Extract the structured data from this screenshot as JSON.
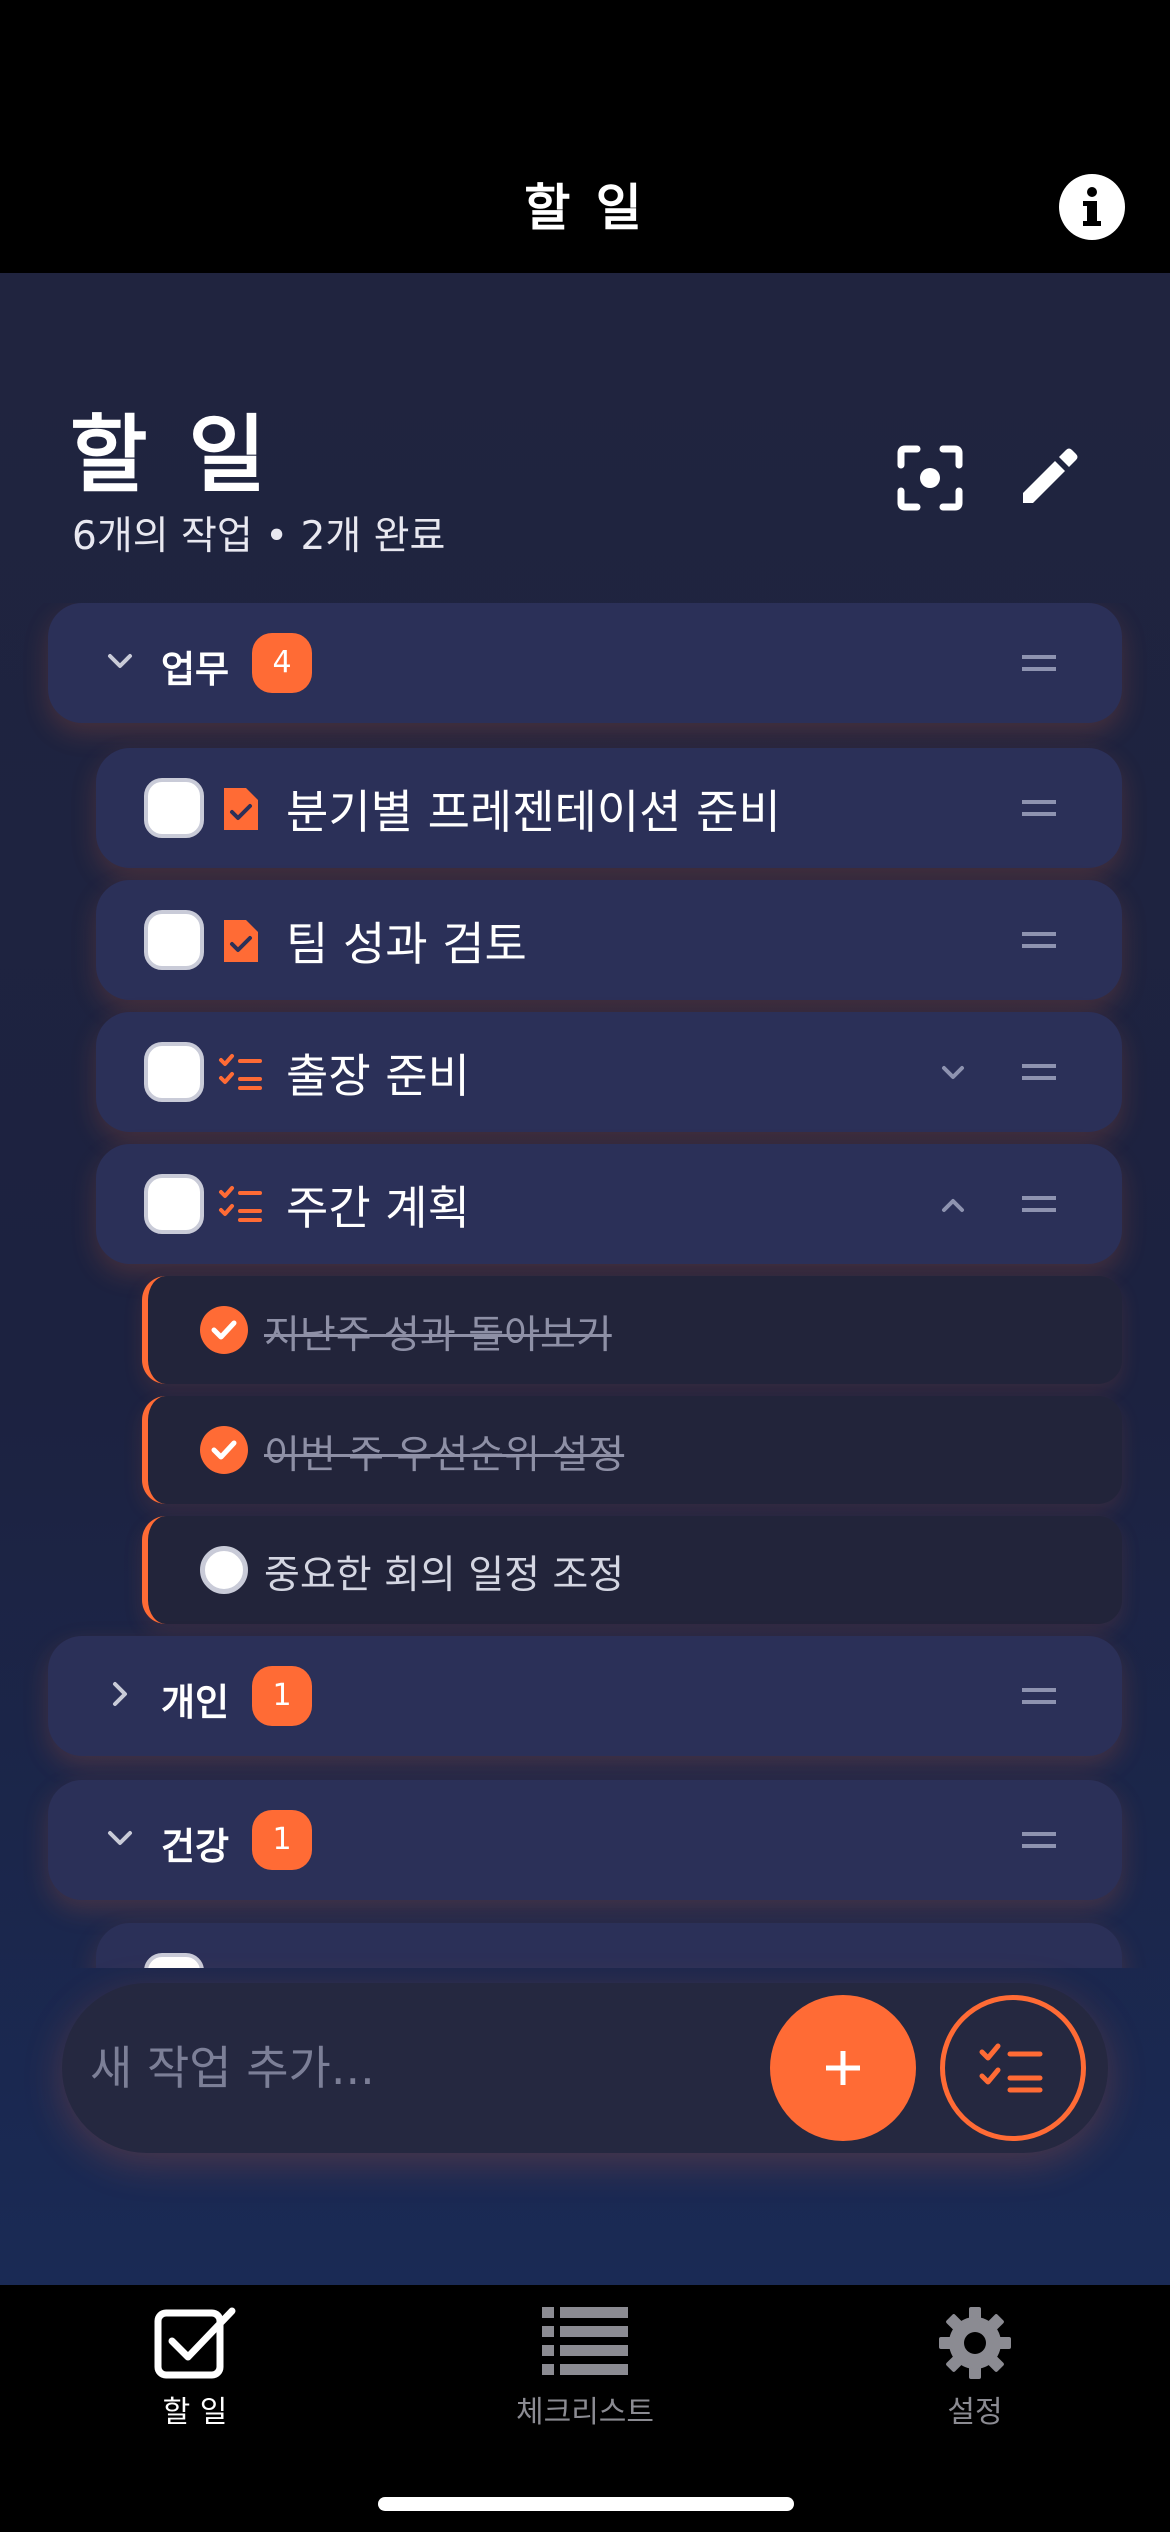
{
  "nav": {
    "title": "할 일",
    "info_icon": "info-circle-icon"
  },
  "header": {
    "title": "할 일",
    "subtitle": "6개의 작업 • 2개 완료",
    "scan_icon": "scan-icon",
    "edit_icon": "pencil-icon"
  },
  "categories": [
    {
      "label": "업무",
      "count": "4",
      "expanded": true
    },
    {
      "label": "개인",
      "count": "1",
      "expanded": false
    },
    {
      "label": "건강",
      "count": "1",
      "expanded": true
    }
  ],
  "tasks": [
    {
      "text": "분기별 프레젠테이션 준비",
      "icon": "document-check-icon",
      "done": false
    },
    {
      "text": "팀 성과 검토",
      "icon": "document-check-icon",
      "done": false
    },
    {
      "text": "출장 준비",
      "icon": "checklist-icon",
      "done": false,
      "expandable": true,
      "expanded": false
    },
    {
      "text": "주간 계획",
      "icon": "checklist-icon",
      "done": false,
      "expandable": true,
      "expanded": true
    }
  ],
  "subtasks": [
    {
      "text": "지난주 성과 돌아보기",
      "done": true
    },
    {
      "text": "이번 주 우선순위 설정",
      "done": true
    },
    {
      "text": "중요한 회의 일정 조정",
      "done": false
    }
  ],
  "add_bar": {
    "placeholder": "새 작업 추가...",
    "add_icon": "plus-icon",
    "checklist_icon": "checklist-icon"
  },
  "tabs": [
    {
      "label": "할 일",
      "icon": "checkbox-icon",
      "active": true
    },
    {
      "label": "체크리스트",
      "icon": "list-icon",
      "active": false
    },
    {
      "label": "설정",
      "icon": "gear-icon",
      "active": false
    }
  ],
  "colors": {
    "accent": "#ff6b35",
    "card": "#2b3058",
    "background": "#1c2240"
  }
}
